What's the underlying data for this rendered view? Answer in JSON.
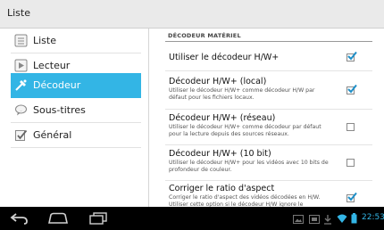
{
  "app": {
    "title": "Liste"
  },
  "sidebar": {
    "items": [
      {
        "label": "Liste",
        "icon": "list-icon",
        "selected": false
      },
      {
        "label": "Lecteur",
        "icon": "player-icon",
        "selected": true,
        "_note": ""
      },
      {
        "label": "Décodeur",
        "icon": "decoder-icon",
        "selected": true
      },
      {
        "label": "Sous-titres",
        "icon": "subtitles-icon",
        "selected": false
      },
      {
        "label": "Général",
        "icon": "general-icon",
        "selected": false
      }
    ]
  },
  "content": {
    "section_header": "DÉCODEUR MATÉRIEL",
    "prefs": [
      {
        "title": "Utiliser le décodeur H/W+",
        "summary": "",
        "checked": true
      },
      {
        "title": "Décodeur H/W+ (local)",
        "summary": "Utiliser le décodeur H/W+ comme décodeur H/W par défaut pour les fichiers locaux.",
        "checked": true
      },
      {
        "title": "Décodeur H/W+ (réseau)",
        "summary": "Utiliser le décodeur H/W+ comme décodeur par défaut pour la lecture depuis des sources réseaux.",
        "checked": false
      },
      {
        "title": "Décodeur H/W+ (10 bit)",
        "summary": "Utiliser le décodeur H/W+ pour les vidéos avec 10 bits de profondeur de couleur.",
        "checked": false
      },
      {
        "title": "Corriger le ratio d'aspect",
        "summary": "Corriger le ratio d'aspect des vidéos décodées en H/W. Utiliser cette option si le décodeur H/W ignore le",
        "checked": true
      }
    ]
  },
  "status": {
    "time": "22:53"
  },
  "colors": {
    "accent": "#33b5e5",
    "actionbar": "#eaeaea",
    "navbar": "#000000"
  },
  "navbar": {
    "icons": [
      "back-icon",
      "home-icon",
      "recent-apps-icon",
      "gallery-icon",
      "screenshot-icon",
      "download-icon",
      "wifi-icon",
      "battery-icon"
    ]
  }
}
